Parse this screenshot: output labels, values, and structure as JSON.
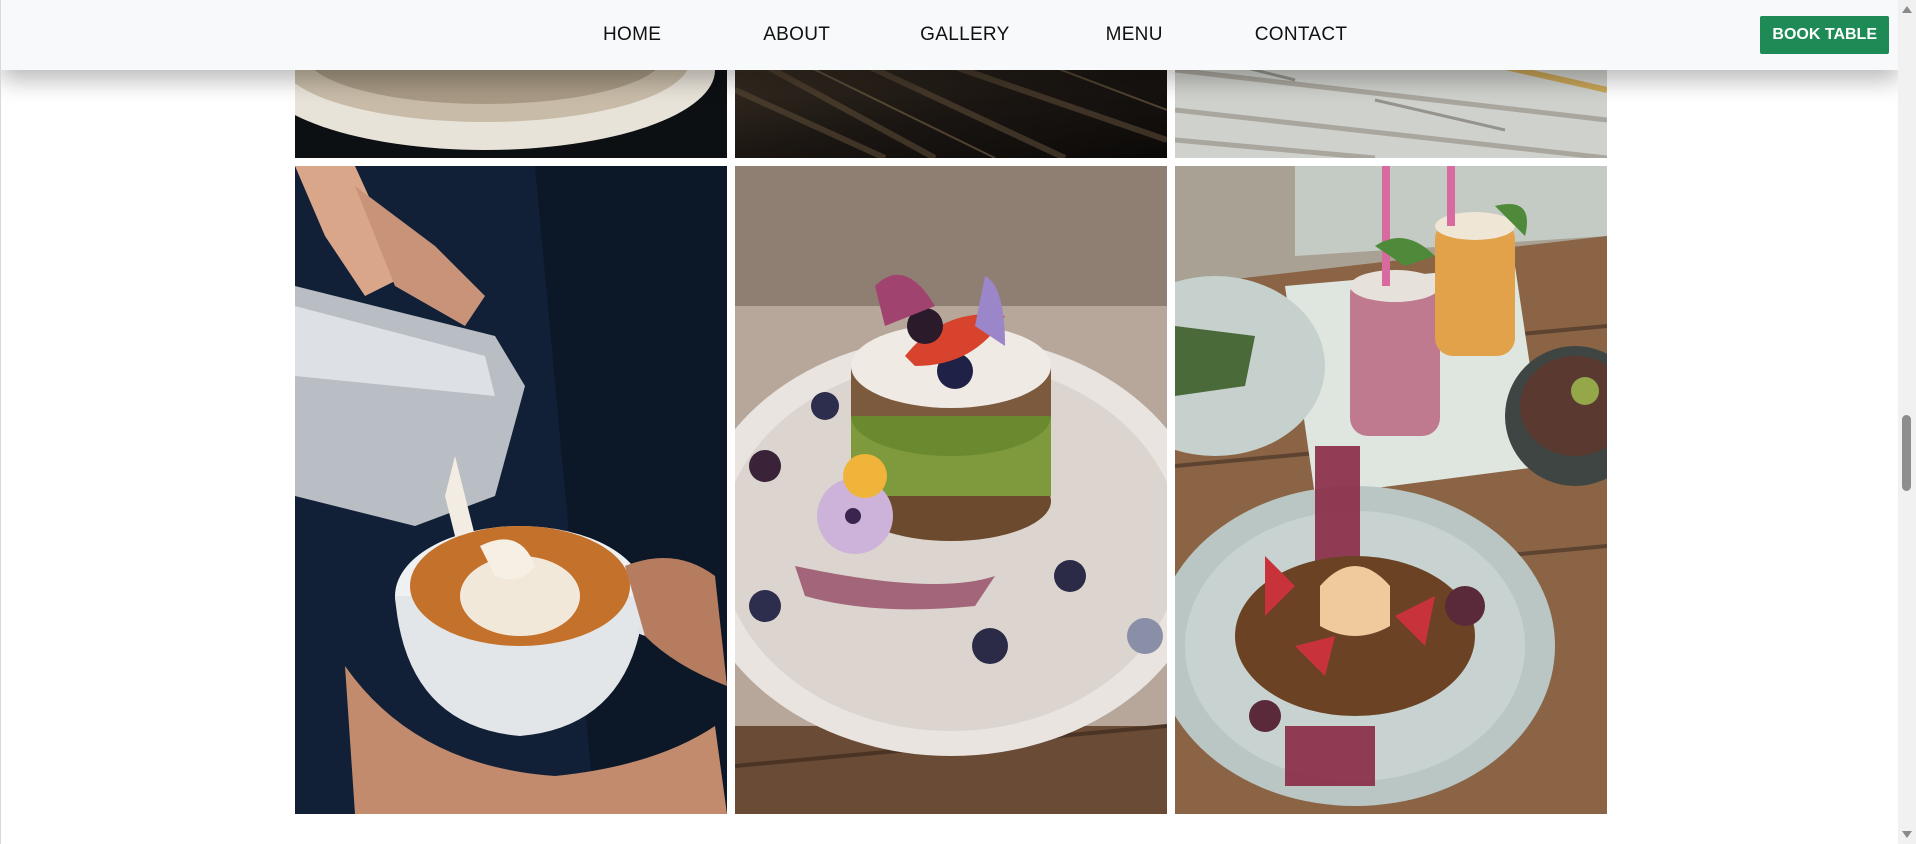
{
  "nav": {
    "items": [
      {
        "label": "HOME"
      },
      {
        "label": "ABOUT"
      },
      {
        "label": "GALLERY"
      },
      {
        "label": "MENU"
      },
      {
        "label": "CONTACT"
      }
    ],
    "book_label": "BOOK TABLE"
  },
  "colors": {
    "navbar_bg": "#f8f9fa",
    "book_button": "#1e8a55",
    "page_bg": "#ffffff"
  },
  "gallery": {
    "images": [
      {
        "name": "ceramic-plate-photo"
      },
      {
        "name": "wood-table-photo"
      },
      {
        "name": "white-painted-wood-photo"
      },
      {
        "name": "latte-pour-photo"
      },
      {
        "name": "pancake-stack-photo"
      },
      {
        "name": "smoothie-bowl-photo"
      }
    ]
  }
}
